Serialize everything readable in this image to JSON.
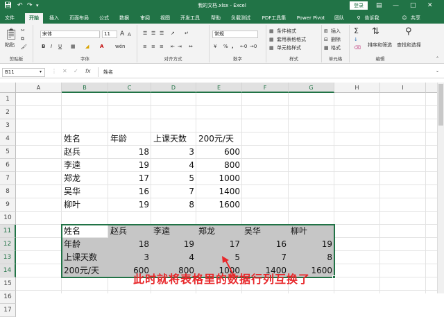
{
  "title_bar": {
    "title": "我的文档.xlsx  -  Excel",
    "login": "登录",
    "qa_icons": [
      "save-icon",
      "undo-icon",
      "redo-icon",
      "customize-icon"
    ]
  },
  "tabs": [
    "文件",
    "开始",
    "插入",
    "页面布局",
    "公式",
    "数据",
    "审阅",
    "视图",
    "开发工具",
    "帮助",
    "负载测试",
    "PDF工具集",
    "Power Pivot",
    "团队",
    "告诉我",
    "共享"
  ],
  "active_tab": "开始",
  "ribbon": {
    "clipboard": {
      "paste": "粘贴",
      "label": "剪贴板"
    },
    "font": {
      "name": "宋体",
      "size": "11",
      "grow": "A",
      "shrink": "A",
      "bold": "B",
      "italic": "I",
      "underline": "U",
      "wen": "wén",
      "label": "字体"
    },
    "alignment": {
      "label": "对齐方式"
    },
    "number": {
      "format": "常规",
      "percent": "%",
      "comma": ",",
      "label": "数字"
    },
    "styles": {
      "conditional": "条件格式",
      "table": "套用表格格式",
      "cell": "单元格样式",
      "label": "样式"
    },
    "cells": {
      "insert": "插入",
      "delete": "删除",
      "format": "格式",
      "label": "单元格"
    },
    "editing": {
      "sigma": "Σ",
      "sort": "排序和筛选",
      "find": "查找和选择",
      "label": "编辑"
    }
  },
  "formula_bar": {
    "name_box": "B11",
    "fx": "fx",
    "content": "姓名"
  },
  "columns": [
    "A",
    "B",
    "C",
    "D",
    "E",
    "F",
    "G",
    "H",
    "I"
  ],
  "rows": [
    "1",
    "2",
    "3",
    "4",
    "5",
    "6",
    "7",
    "8",
    "9",
    "10",
    "11",
    "12",
    "13",
    "14",
    "15",
    "16",
    "17"
  ],
  "table1": {
    "header": [
      "姓名",
      "年龄",
      "上课天数",
      "200元/天"
    ],
    "rows": [
      [
        "赵兵",
        "18",
        "3",
        "600"
      ],
      [
        "李逵",
        "19",
        "4",
        "800"
      ],
      [
        "郑龙",
        "17",
        "5",
        "1000"
      ],
      [
        "吴华",
        "16",
        "7",
        "1400"
      ],
      [
        "柳叶",
        "19",
        "8",
        "1600"
      ]
    ]
  },
  "table2": {
    "rows": [
      [
        "姓名",
        "赵兵",
        "李逵",
        "郑龙",
        "吴华",
        "柳叶"
      ],
      [
        "年龄",
        "18",
        "19",
        "17",
        "16",
        "19"
      ],
      [
        "上课天数",
        "3",
        "4",
        "5",
        "7",
        "8"
      ],
      [
        "200元/天",
        "600",
        "800",
        "1000",
        "1400",
        "1600"
      ]
    ]
  },
  "annotation": "此时就将表格里的数据行列互换了",
  "colors": {
    "accent": "#217346",
    "annotation": "#e8272a",
    "selection_fill": "#c6c6c6"
  }
}
